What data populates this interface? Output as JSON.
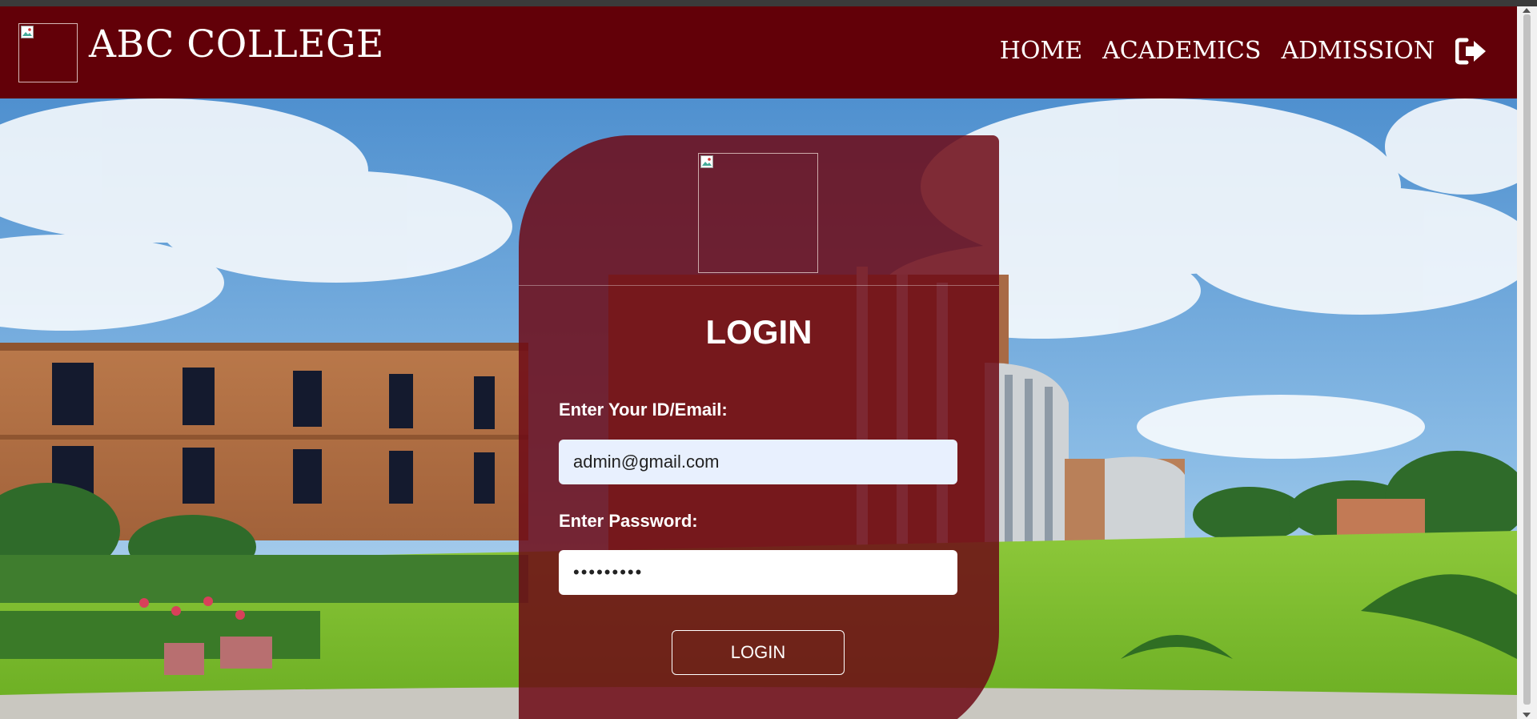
{
  "navbar": {
    "brand_name": "ABC COLLEGE",
    "links": [
      "HOME",
      "ACADEMICS",
      "ADMISSION"
    ],
    "logout_icon": "sign-out-icon"
  },
  "login": {
    "title": "LOGIN",
    "email_label": "Enter Your ID/Email:",
    "email_value": "admin@gmail.com",
    "password_label": "Enter Password:",
    "password_value": "•••••••••",
    "button_label": "LOGIN"
  },
  "colors": {
    "navbar": "#620008",
    "card": "#6e0a16",
    "email_autofill": "#e8f0fe"
  }
}
